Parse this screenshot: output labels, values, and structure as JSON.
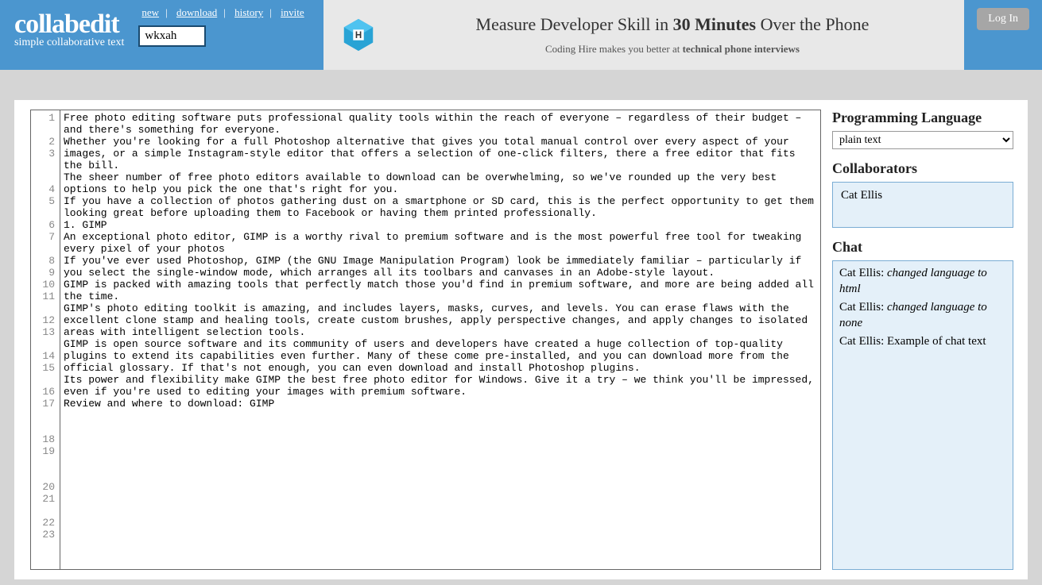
{
  "header": {
    "logo": "collabedit",
    "tagline": "simple collaborative text",
    "nav": {
      "new": "new",
      "download": "download",
      "history": "history",
      "invite": "invite"
    },
    "code": "wkxah",
    "login": "Log In"
  },
  "banner": {
    "title_pre": "Measure Developer Skill in ",
    "title_bold": "30 Minutes",
    "title_post": " Over the Phone",
    "sub_pre": "Coding Hire makes you better at ",
    "sub_bold": "technical phone interviews"
  },
  "editor": {
    "lines": [
      "Free photo editing software puts professional quality tools within the reach of everyone – regardless of their budget – and there's something for everyone.",
      "",
      "Whether you're looking for a full Photoshop alternative that gives you total manual control over every aspect of your images, or a simple Instagram-style editor that offers a selection of one-click filters, there a free editor that fits the bill.",
      "",
      "The sheer number of free photo editors available to download can be overwhelming, so we've rounded up the very best options to help you pick the one that's right for you.",
      "",
      "If you have a collection of photos gathering dust on a smartphone or SD card, this is the perfect opportunity to get them looking great before uploading them to Facebook or having them printed professionally.",
      "",
      "1. GIMP",
      "",
      "An exceptional photo editor, GIMP is a worthy rival to premium software and is the most powerful free tool for tweaking every pixel of your photos",
      "",
      "If you've ever used Photoshop, GIMP (the GNU Image Manipulation Program) look be immediately familiar – particularly if you select the single-window mode, which arranges all its toolbars and canvases in an Adobe-style layout.",
      "",
      "GIMP is packed with amazing tools that perfectly match those you'd find in premium software, and more are being added all the time.",
      "",
      "GIMP's photo editing toolkit is amazing, and includes layers, masks, curves, and levels. You can erase flaws with the excellent clone stamp and healing tools, create custom brushes, apply perspective changes, and apply changes to isolated areas with intelligent selection tools.",
      "",
      "GIMP is open source software and its community of users and developers have created a huge collection of top-quality plugins to extend its capabilities even further. Many of these come pre-installed, and you can download more from the official glossary. If that's not enough, you can even download and install Photoshop plugins.",
      "",
      "Its power and flexibility make GIMP the best free photo editor for Windows. Give it a try – we think you'll be impressed, even if you're used to editing your images with premium software.",
      "",
      "Review and where to download: GIMP"
    ]
  },
  "sidebar": {
    "lang_heading": "Programming Language",
    "lang_value": "plain text",
    "collab_heading": "Collaborators",
    "collaborators": [
      "Cat Ellis"
    ],
    "chat_heading": "Chat",
    "chat": [
      {
        "user": "Cat Ellis",
        "msg": "changed language to html",
        "italic": true
      },
      {
        "user": "Cat Ellis",
        "msg": "changed language to none",
        "italic": true
      },
      {
        "user": "Cat Ellis",
        "msg": "Example of chat text",
        "italic": false
      }
    ]
  }
}
